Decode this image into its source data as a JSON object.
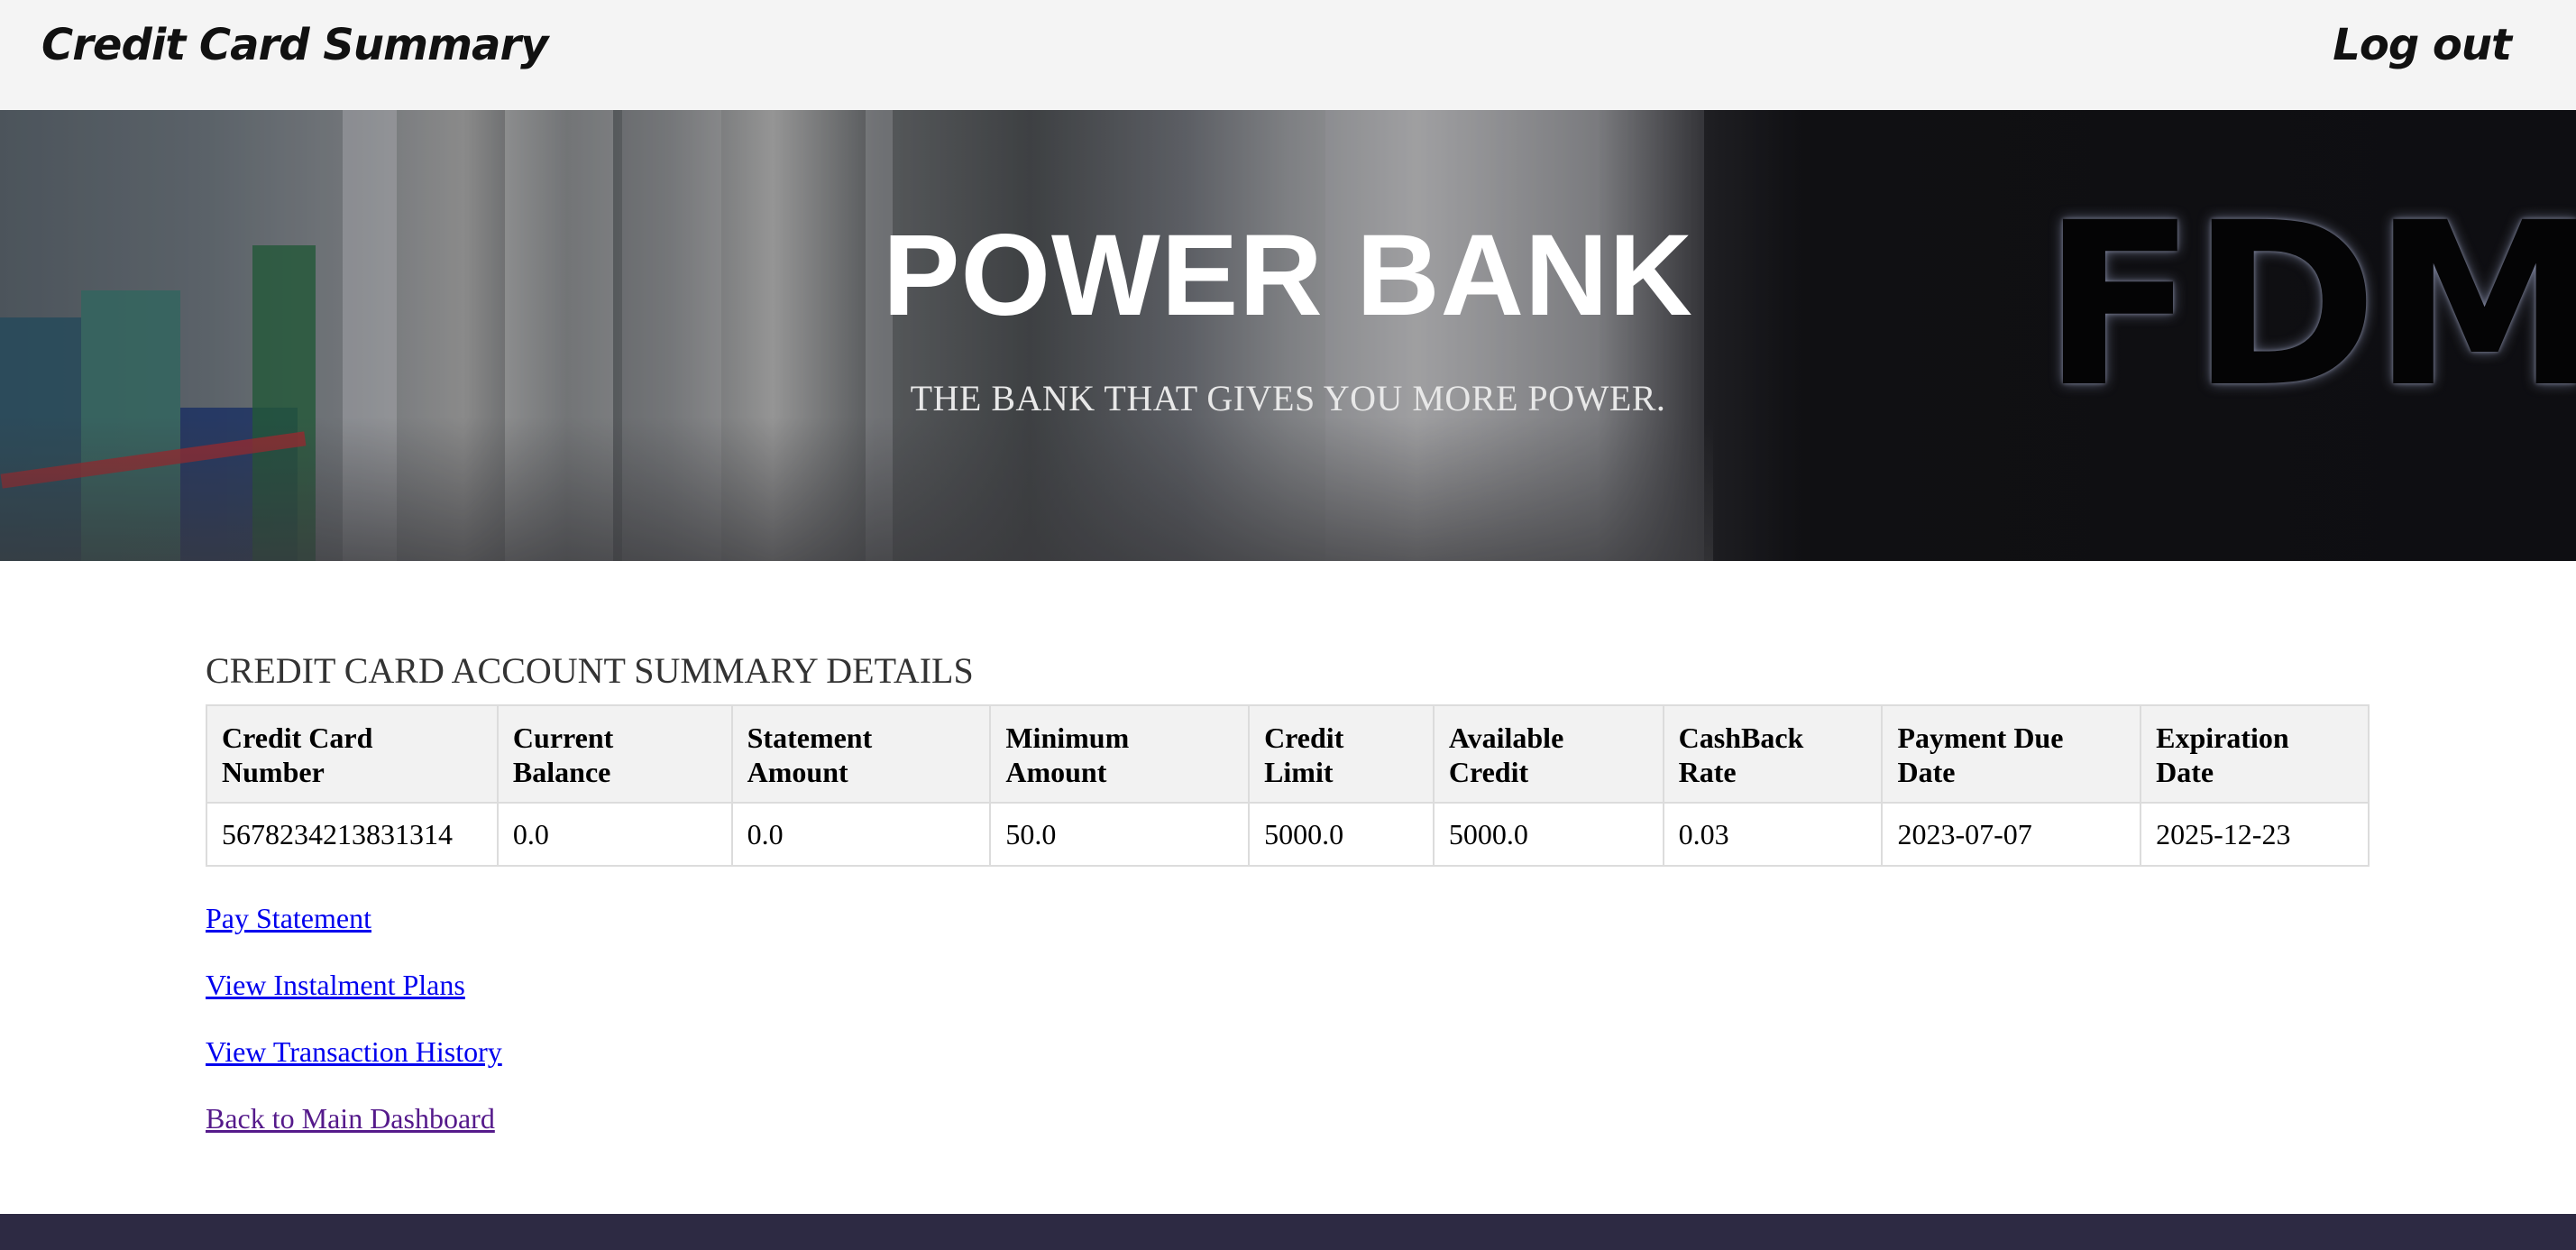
{
  "navbar": {
    "title": "Credit Card Summary",
    "logout_label": "Log out"
  },
  "hero": {
    "bank_name": "POWER BANK",
    "tagline": "THE BANK THAT GIVES YOU MORE POWER.",
    "logo_text": "FDM"
  },
  "summary": {
    "heading": "CREDIT CARD ACCOUNT SUMMARY DETAILS",
    "columns": [
      [
        "Credit Card",
        "Number"
      ],
      [
        "Current",
        "Balance"
      ],
      [
        "Statement",
        "Amount"
      ],
      [
        "Minimum",
        "Amount"
      ],
      [
        "Credit",
        "Limit"
      ],
      [
        "Available",
        "Credit"
      ],
      [
        "CashBack",
        "Rate"
      ],
      [
        "Payment Due",
        "Date"
      ],
      [
        "Expiration",
        "Date"
      ]
    ],
    "rows": [
      [
        "5678234213831314",
        "0.0",
        "0.0",
        "50.0",
        "5000.0",
        "5000.0",
        "0.03",
        "2023-07-07",
        "2025-12-23"
      ]
    ]
  },
  "links": {
    "pay_statement": "Pay Statement",
    "view_instalment_plans": "View Instalment Plans",
    "view_transaction_history": "View Transaction History",
    "back_to_dashboard": "Back to Main Dashboard"
  },
  "colors": {
    "navbar_bg": "#f4f4f4",
    "link": "#0000ee",
    "visited_link": "#551a8b",
    "footer_bg": "#2d2a43"
  }
}
